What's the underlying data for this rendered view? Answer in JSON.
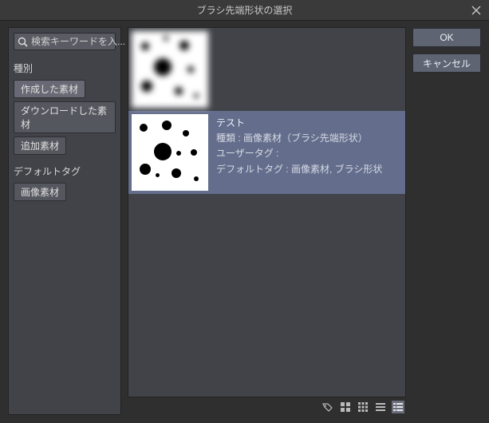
{
  "title": "ブラシ先端形状の選択",
  "buttons": {
    "ok": "OK",
    "cancel": "キャンセル"
  },
  "search": {
    "placeholder": "検索キーワードを入..."
  },
  "sidebar": {
    "group_kind_label": "種別",
    "kinds": [
      {
        "label": "作成した素材",
        "active": true
      },
      {
        "label": "ダウンロードした素材",
        "active": false
      },
      {
        "label": "追加素材",
        "active": false
      }
    ],
    "group_tag_label": "デフォルトタグ",
    "tags": [
      {
        "label": "画像素材",
        "active": false
      }
    ]
  },
  "items": [
    {
      "name": "",
      "kind_line": "",
      "usertag_line": "",
      "default_line": "",
      "blurred": true,
      "selected": false
    },
    {
      "name": "テスト",
      "kind_line": "種類 : 画像素材（ブラシ先端形状）",
      "usertag_line": "ユーザータグ :",
      "default_line": "デフォルトタグ : 画像素材, ブラシ形状",
      "blurred": false,
      "selected": true
    }
  ],
  "footer_icons": [
    "tag-icon",
    "view-large-icon",
    "view-grid-icon",
    "view-list-icon",
    "view-detail-icon"
  ]
}
